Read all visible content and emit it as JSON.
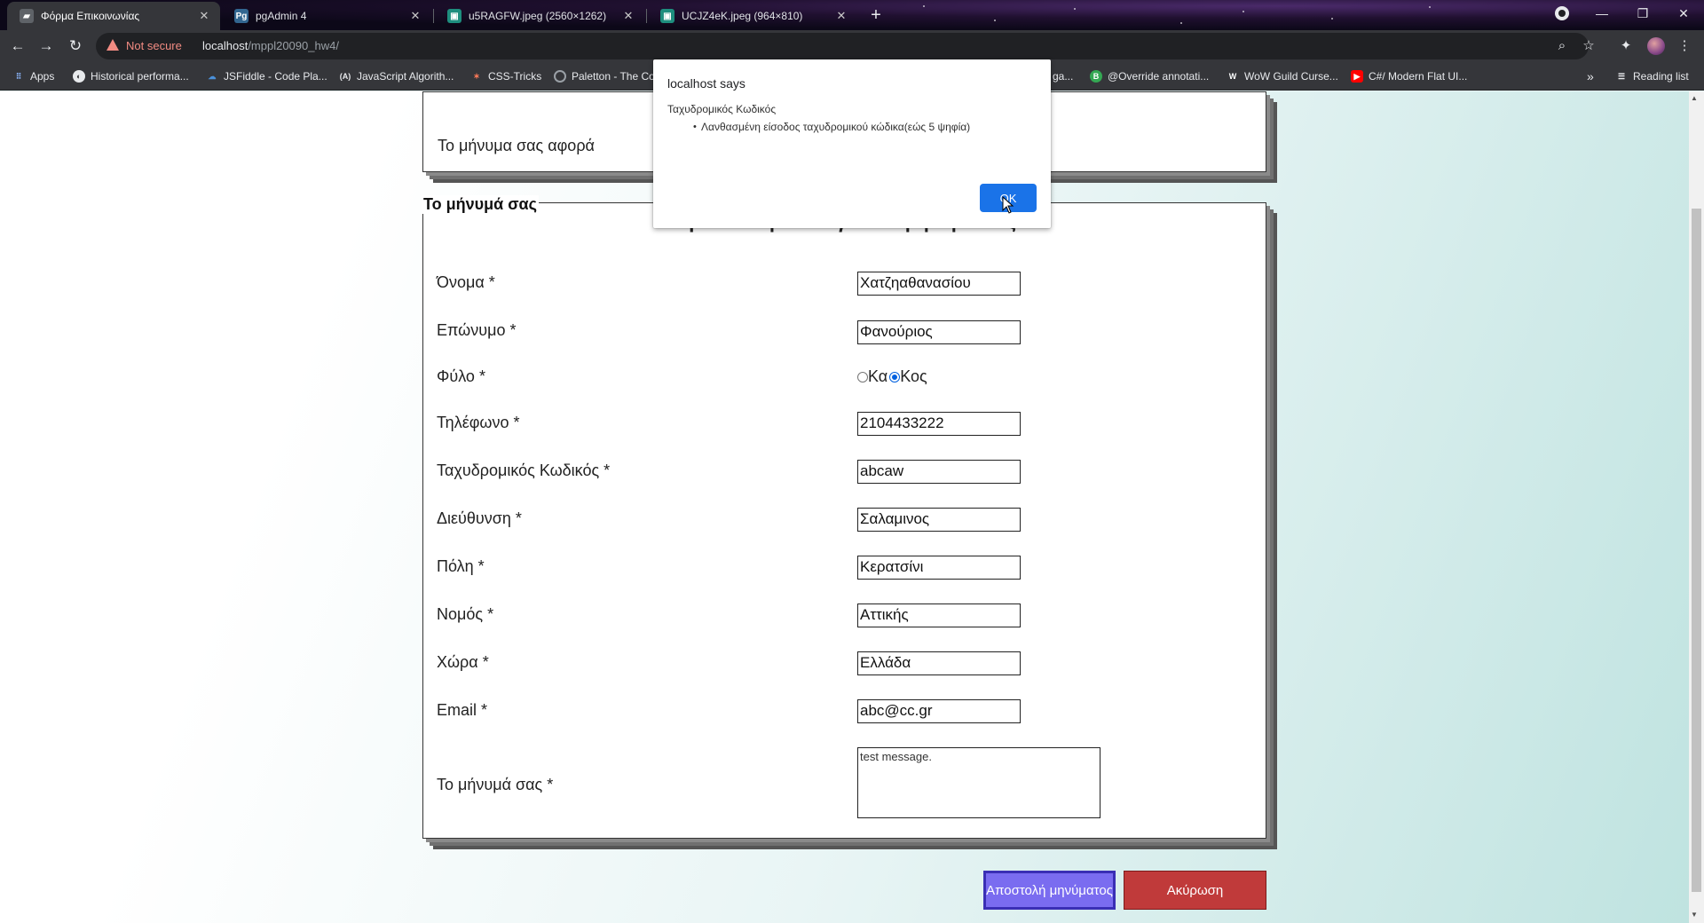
{
  "browser": {
    "tabs": [
      {
        "title": "Φόρμα Επικοινωνίας",
        "icon": "page-icon",
        "active": true
      },
      {
        "title": "pgAdmin 4",
        "icon": "pgadmin-icon",
        "active": false
      },
      {
        "title": "u5RAGFW.jpeg (2560×1262)",
        "icon": "image-icon",
        "active": false
      },
      {
        "title": "UCJZ4eK.jpeg (964×810)",
        "icon": "image-icon",
        "active": false
      }
    ],
    "security_label": "Not secure",
    "url_host": "localhost",
    "url_path": "/mppl20090_hw4/",
    "bookmarks": [
      {
        "label": "Apps",
        "icon": "apps-icon"
      },
      {
        "label": "Historical performa...",
        "icon": "globe-icon"
      },
      {
        "label": "JSFiddle - Code Pla...",
        "icon": "jsfiddle-icon"
      },
      {
        "label": "JavaScript Algorith...",
        "icon": "algorithm-icon"
      },
      {
        "label": "CSS-Tricks",
        "icon": "star-icon"
      },
      {
        "label": "Paletton - The Co",
        "icon": "palette-icon"
      },
      {
        "label": "ga...",
        "icon": "page-icon"
      },
      {
        "label": "@Override annotati...",
        "icon": "b-icon"
      },
      {
        "label": "WoW Guild Curse...",
        "icon": "w-icon"
      },
      {
        "label": "C#/ Modern Flat UI...",
        "icon": "youtube-icon"
      }
    ],
    "more_bookmarks": "»",
    "reading_list": "Reading list"
  },
  "page": {
    "subject_label": "Το μήνυμα σας αφορά",
    "fieldset_legend": "Το μήνυμά σας",
    "hidden_heading": "Παρακαλούμε εισάγετε το μήνυμά σας",
    "fields": [
      {
        "label": "Όνομα *",
        "value": "Χατζηαθανασίου"
      },
      {
        "label": "Επώνυμο *",
        "value": "Φανούριος"
      },
      {
        "label": "Τηλέφωνο *",
        "value": "2104433222"
      },
      {
        "label": "Ταχυδρομικός Κωδικός *",
        "value": "abcaw"
      },
      {
        "label": "Διεύθυνση *",
        "value": "Σαλαμινος"
      },
      {
        "label": "Πόλη *",
        "value": "Κερατσίνι"
      },
      {
        "label": "Νομός *",
        "value": "Αττικής"
      },
      {
        "label": "Χώρα *",
        "value": "Ελλάδα"
      },
      {
        "label": "Email *",
        "value": "abc@cc.gr"
      }
    ],
    "gender": {
      "label": "Φύλο *",
      "option_female": "Κα",
      "option_male": "Κος",
      "selected": "Κος"
    },
    "message": {
      "label": "Το μήνυμά σας *",
      "value": "test message."
    },
    "submit_label": "Αποστολή μηνύματος",
    "cancel_label": "Ακύρωση"
  },
  "dialog": {
    "title": "localhost says",
    "line1": "Ταχυδρομικός Κωδικός",
    "line2": "Λανθασμένη είσοδος ταχυδρομικού κώδικα(εώς 5 ψηφία)",
    "ok_label": "OK"
  }
}
